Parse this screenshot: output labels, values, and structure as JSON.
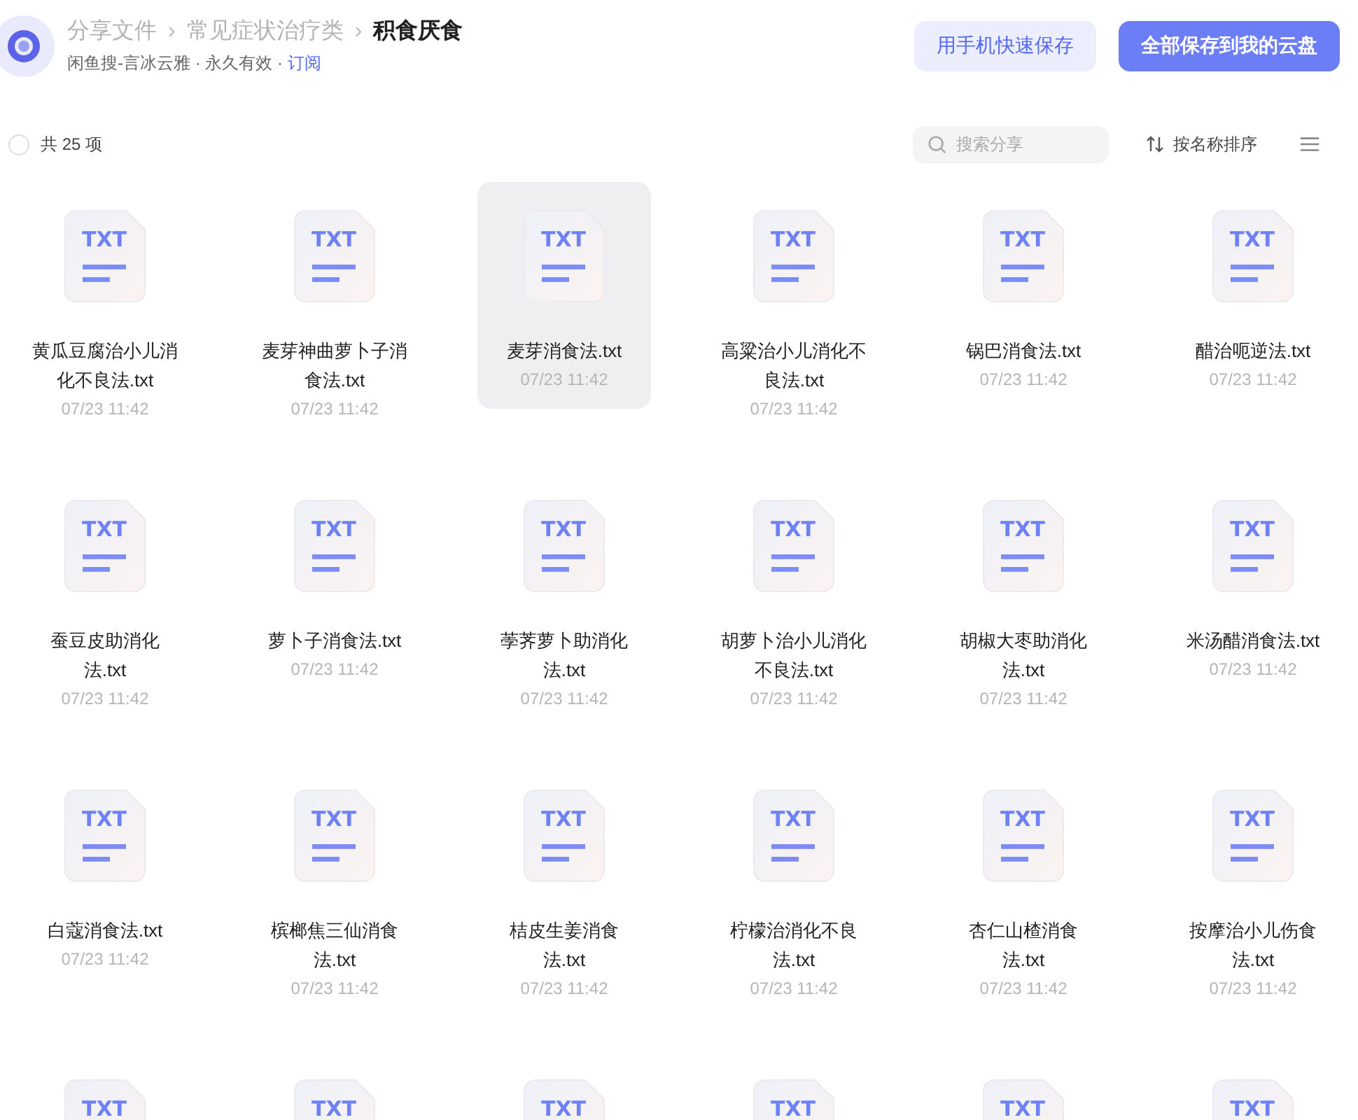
{
  "header": {
    "breadcrumb": [
      {
        "label": "分享文件",
        "current": false
      },
      {
        "label": "常见症状治疗类",
        "current": false
      },
      {
        "label": "积食厌食",
        "current": true
      }
    ],
    "separator": "›",
    "meta": {
      "text": "闲鱼搜-言冰云雅 · 永久有效 · ",
      "link": "订阅"
    },
    "buttons": [
      {
        "label": "用手机快速保存",
        "kind": "secondary"
      },
      {
        "label": "全部保存到我的云盘",
        "kind": "primary"
      }
    ]
  },
  "toolbar": {
    "select_all": {
      "checked": false
    },
    "count": "共 25 项",
    "search": {
      "placeholder": "搜索分享"
    },
    "sort": "按名称排序"
  },
  "files": [
    {
      "type_label": "TXT",
      "name": "黄瓜豆腐治小儿消化不良法.txt",
      "date": "07/23 11:42",
      "selected": false
    },
    {
      "type_label": "TXT",
      "name": "麦芽神曲萝卜子消食法.txt",
      "date": "07/23 11:42",
      "selected": false
    },
    {
      "type_label": "TXT",
      "name": "麦芽消食法.txt",
      "date": "07/23 11:42",
      "selected": true
    },
    {
      "type_label": "TXT",
      "name": "高粱治小儿消化不良法.txt",
      "date": "07/23 11:42",
      "selected": false
    },
    {
      "type_label": "TXT",
      "name": "锅巴消食法.txt",
      "date": "07/23 11:42",
      "selected": false
    },
    {
      "type_label": "TXT",
      "name": "醋治呃逆法.txt",
      "date": "07/23 11:42",
      "selected": false
    },
    {
      "type_label": "TXT",
      "name": "蚕豆皮助消化法.txt",
      "date": "07/23 11:42",
      "selected": false
    },
    {
      "type_label": "TXT",
      "name": "萝卜子消食法.txt",
      "date": "07/23 11:42",
      "selected": false
    },
    {
      "type_label": "TXT",
      "name": "荸荠萝卜助消化法.txt",
      "date": "07/23 11:42",
      "selected": false
    },
    {
      "type_label": "TXT",
      "name": "胡萝卜治小儿消化不良法.txt",
      "date": "07/23 11:42",
      "selected": false
    },
    {
      "type_label": "TXT",
      "name": "胡椒大枣助消化法.txt",
      "date": "07/23 11:42",
      "selected": false
    },
    {
      "type_label": "TXT",
      "name": "米汤醋消食法.txt",
      "date": "07/23 11:42",
      "selected": false
    },
    {
      "type_label": "TXT",
      "name": "白蔻消食法.txt",
      "date": "07/23 11:42",
      "selected": false
    },
    {
      "type_label": "TXT",
      "name": "槟榔焦三仙消食法.txt",
      "date": "07/23 11:42",
      "selected": false
    },
    {
      "type_label": "TXT",
      "name": "桔皮生姜消食法.txt",
      "date": "07/23 11:42",
      "selected": false
    },
    {
      "type_label": "TXT",
      "name": "柠檬治消化不良法.txt",
      "date": "07/23 11:42",
      "selected": false
    },
    {
      "type_label": "TXT",
      "name": "杏仁山楂消食法.txt",
      "date": "07/23 11:42",
      "selected": false
    },
    {
      "type_label": "TXT",
      "name": "按摩治小儿伤食法.txt",
      "date": "07/23 11:42",
      "selected": false
    },
    {
      "type_label": "TXT",
      "selected": false
    },
    {
      "type_label": "TXT",
      "selected": false
    },
    {
      "type_label": "TXT",
      "selected": false
    },
    {
      "type_label": "TXT",
      "selected": false
    },
    {
      "type_label": "TXT",
      "selected": false
    },
    {
      "type_label": "TXT",
      "selected": false
    }
  ]
}
